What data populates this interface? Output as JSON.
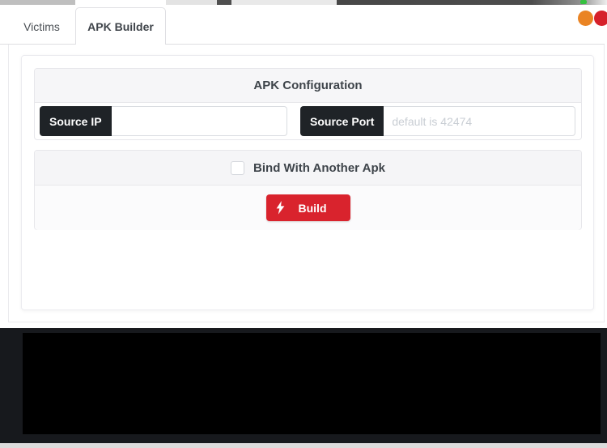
{
  "window": {
    "controls": [
      {
        "name": "orange-dot",
        "color": "#ea8424"
      },
      {
        "name": "red-dot",
        "color": "#d6202a"
      }
    ],
    "green_indicator_color": "#35c13f"
  },
  "tabs": [
    {
      "label": "Victims",
      "active": false
    },
    {
      "label": "APK Builder",
      "active": true
    }
  ],
  "builder": {
    "config_title": "APK Configuration",
    "fields": [
      {
        "label": "Source IP",
        "value": "",
        "placeholder": ""
      },
      {
        "label": "Source Port",
        "value": "",
        "placeholder": "default is 42474"
      }
    ],
    "bind_checkbox": {
      "label": "Bind With Another Apk",
      "checked": false
    },
    "build_button": {
      "label": "Build",
      "icon": "lightning-icon",
      "color": "#d9232d"
    }
  },
  "console": {
    "content": ""
  }
}
